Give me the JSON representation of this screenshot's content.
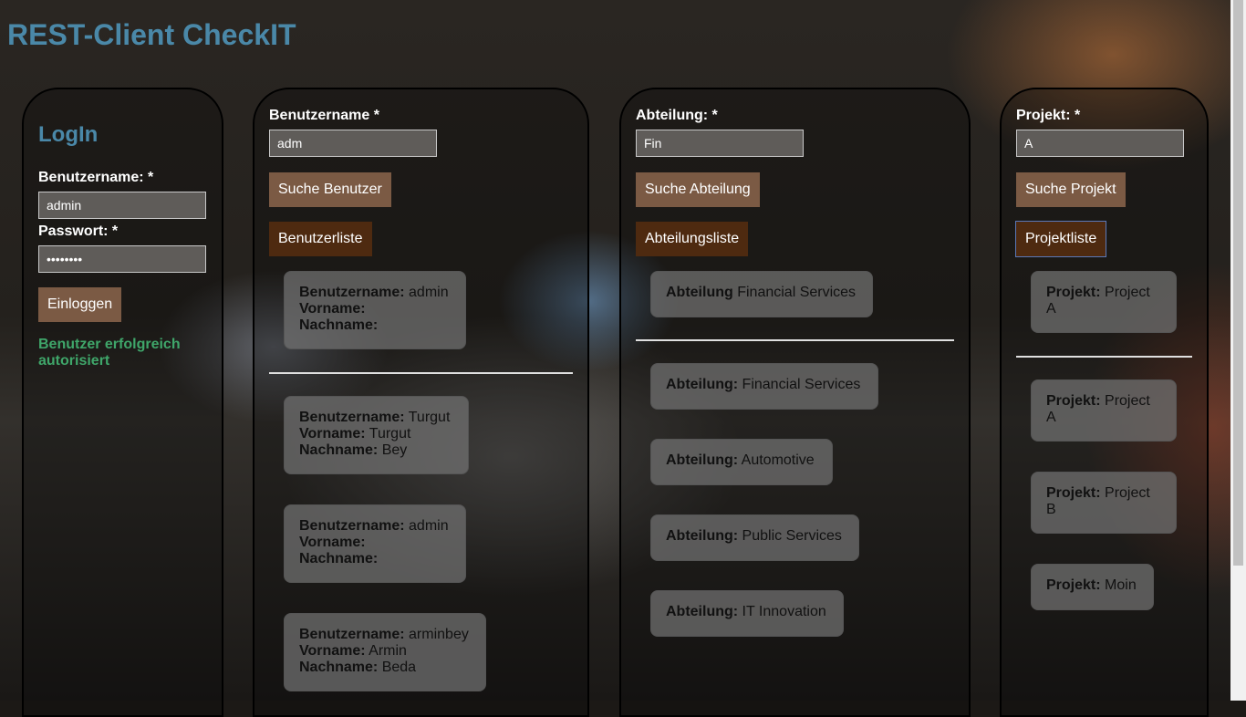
{
  "app": {
    "title": "REST-Client CheckIT"
  },
  "login": {
    "title": "LogIn",
    "username_label": "Benutzername: *",
    "username_value": "admin",
    "password_label": "Passwort: *",
    "password_value": "••••••••",
    "login_button": "Einloggen",
    "status": "Benutzer erfolgreich autorisiert"
  },
  "users": {
    "label": "Benutzername *",
    "search_value": "adm",
    "search_button": "Suche Benutzer",
    "list_button": "Benutzerliste",
    "field_username": "Benutzername:",
    "field_firstname": "Vorname:",
    "field_lastname": "Nachname:",
    "result": {
      "username": "admin",
      "firstname": "",
      "lastname": ""
    },
    "list": [
      {
        "username": "Turgut",
        "firstname": "Turgut",
        "lastname": "Bey"
      },
      {
        "username": "admin",
        "firstname": "",
        "lastname": ""
      },
      {
        "username": "arminbey",
        "firstname": "Armin",
        "lastname": "Beda"
      }
    ]
  },
  "departments": {
    "label": "Abteilung: *",
    "search_value": "Fin",
    "search_button": "Suche Abteilung",
    "list_button": "Abteilungsliste",
    "result_label": "Abteilung",
    "result_value": "Financial Services",
    "field_label": "Abteilung:",
    "list": [
      "Financial Services",
      "Automotive",
      "Public Services",
      "IT Innovation"
    ]
  },
  "projects": {
    "label": "Projekt: *",
    "search_value": "A",
    "search_button": "Suche Projekt",
    "list_button": "Projektliste",
    "field_label": "Projekt:",
    "result_value": "Project A",
    "list": [
      "Project A",
      "Project B",
      "Moin"
    ]
  }
}
